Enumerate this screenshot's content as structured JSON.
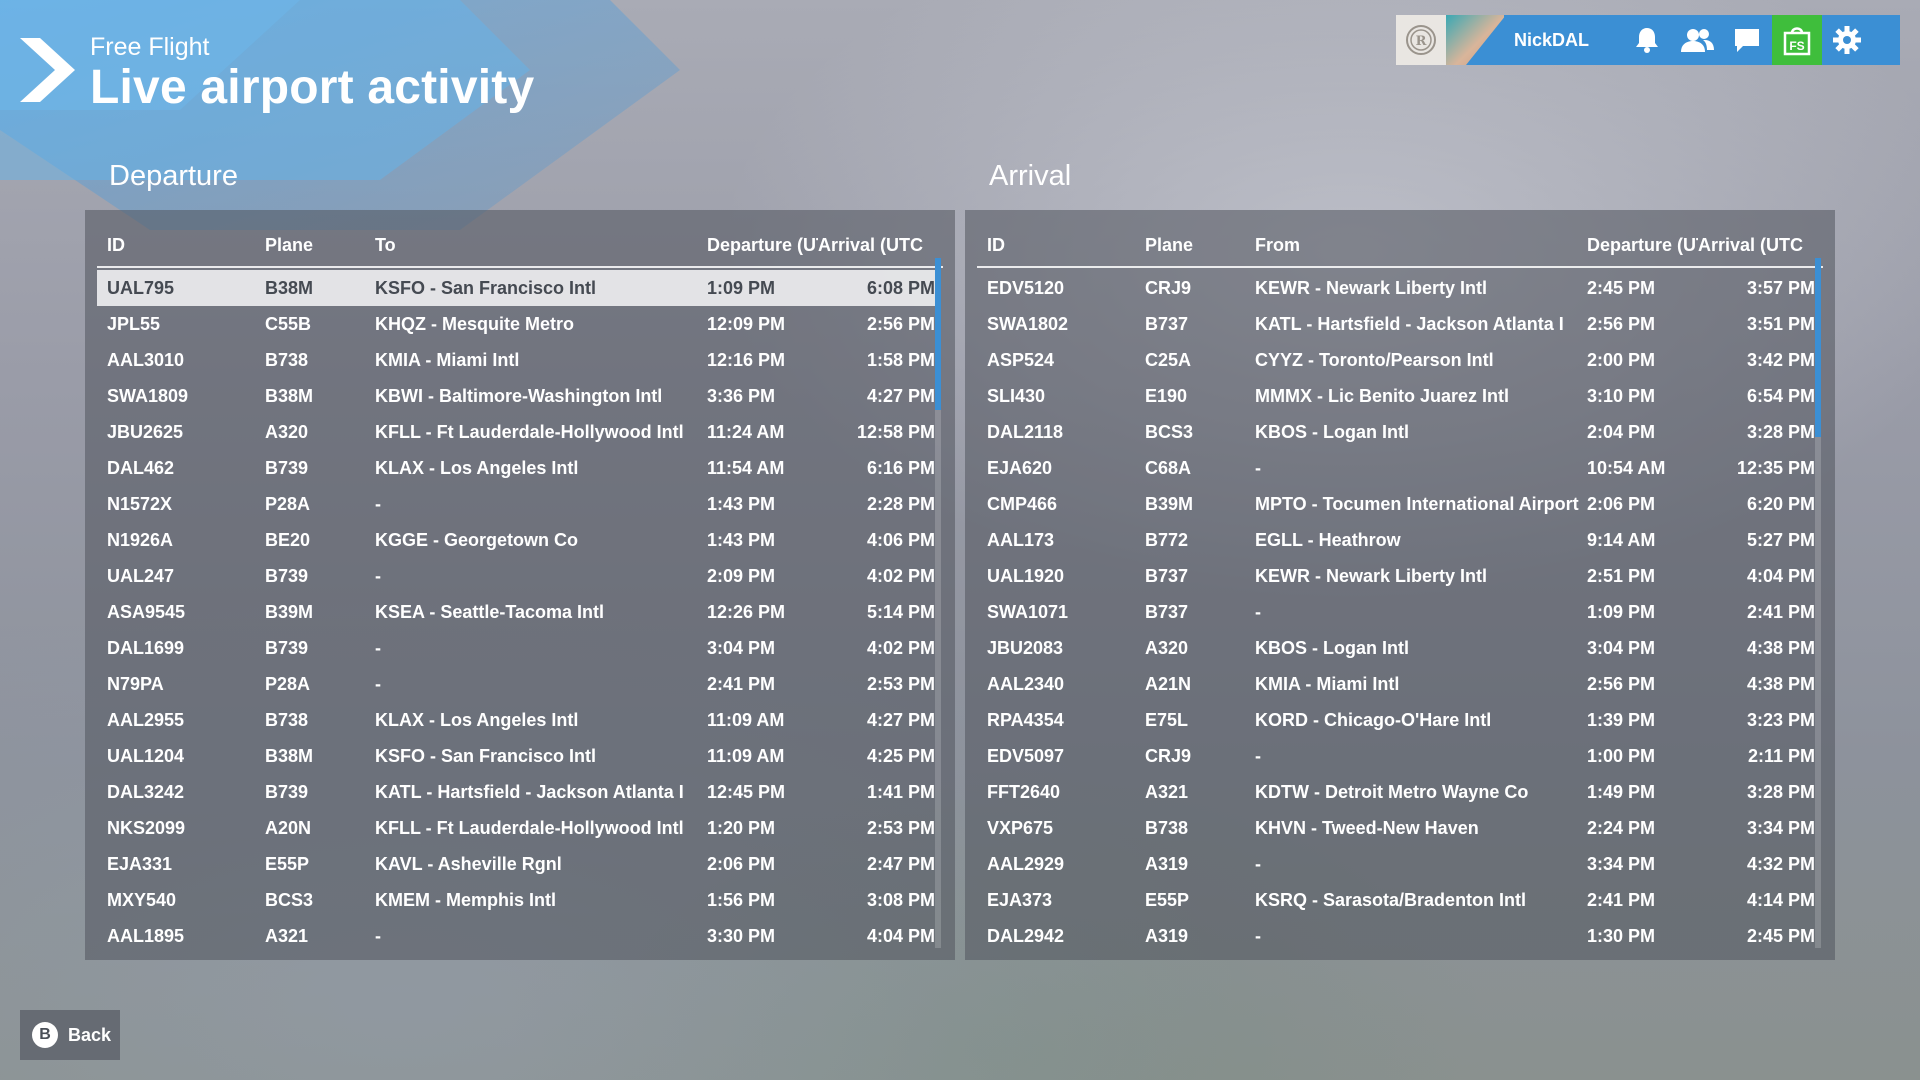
{
  "header": {
    "supertitle": "Free Flight",
    "title": "Live airport activity"
  },
  "topbar": {
    "username": "NickDAL",
    "icons": [
      "profile-badge-icon",
      "bell-icon",
      "friends-icon",
      "chat-icon",
      "store-icon",
      "gear-icon"
    ],
    "store_label": "FS",
    "store_color": "#3fbe3c",
    "accent_color": "#3b8fd4"
  },
  "departure": {
    "title": "Departure",
    "headers": [
      "ID",
      "Plane",
      "To",
      "Departure (UTC)",
      "Arrival (UTC)"
    ],
    "selected_row": 0,
    "rows": [
      [
        "UAL795",
        "B38M",
        "KSFO - San Francisco Intl",
        "1:09 PM",
        "6:08 PM"
      ],
      [
        "JPL55",
        "C55B",
        "KHQZ - Mesquite Metro",
        "12:09 PM",
        "2:56 PM"
      ],
      [
        "AAL3010",
        "B738",
        "KMIA - Miami Intl",
        "12:16 PM",
        "1:58 PM"
      ],
      [
        "SWA1809",
        "B38M",
        "KBWI - Baltimore-Washington Intl",
        "3:36 PM",
        "4:27 PM"
      ],
      [
        "JBU2625",
        "A320",
        "KFLL - Ft Lauderdale-Hollywood Intl",
        "11:24 AM",
        "12:58 PM"
      ],
      [
        "DAL462",
        "B739",
        "KLAX - Los Angeles Intl",
        "11:54 AM",
        "6:16 PM"
      ],
      [
        "N1572X",
        "P28A",
        "-",
        "1:43 PM",
        "2:28 PM"
      ],
      [
        "N1926A",
        "BE20",
        "KGGE - Georgetown Co",
        "1:43 PM",
        "4:06 PM"
      ],
      [
        "UAL247",
        "B739",
        "-",
        "2:09 PM",
        "4:02 PM"
      ],
      [
        "ASA9545",
        "B39M",
        "KSEA - Seattle-Tacoma Intl",
        "12:26 PM",
        "5:14 PM"
      ],
      [
        "DAL1699",
        "B739",
        "-",
        "3:04 PM",
        "4:02 PM"
      ],
      [
        "N79PA",
        "P28A",
        "-",
        "2:41 PM",
        "2:53 PM"
      ],
      [
        "AAL2955",
        "B738",
        "KLAX - Los Angeles Intl",
        "11:09 AM",
        "4:27 PM"
      ],
      [
        "UAL1204",
        "B38M",
        "KSFO - San Francisco Intl",
        "11:09 AM",
        "4:25 PM"
      ],
      [
        "DAL3242",
        "B739",
        "KATL - Hartsfield - Jackson Atlanta I",
        "12:45 PM",
        "1:41 PM"
      ],
      [
        "NKS2099",
        "A20N",
        "KFLL - Ft Lauderdale-Hollywood Intl",
        "1:20 PM",
        "2:53 PM"
      ],
      [
        "EJA331",
        "E55P",
        "KAVL - Asheville Rgnl",
        "2:06 PM",
        "2:47 PM"
      ],
      [
        "MXY540",
        "BCS3",
        "KMEM - Memphis Intl",
        "1:56 PM",
        "3:08 PM"
      ],
      [
        "AAL1895",
        "A321",
        "-",
        "3:30 PM",
        "4:04 PM"
      ]
    ],
    "scroll_fraction": 0.22
  },
  "arrival": {
    "title": "Arrival",
    "headers": [
      "ID",
      "Plane",
      "From",
      "Departure (UTC)",
      "Arrival (UTC)"
    ],
    "rows": [
      [
        "EDV5120",
        "CRJ9",
        "KEWR - Newark Liberty Intl",
        "2:45 PM",
        "3:57 PM"
      ],
      [
        "SWA1802",
        "B737",
        "KATL - Hartsfield - Jackson Atlanta I",
        "2:56 PM",
        "3:51 PM"
      ],
      [
        "ASP524",
        "C25A",
        "CYYZ - Toronto/Pearson Intl",
        "2:00 PM",
        "3:42 PM"
      ],
      [
        "SLI430",
        "E190",
        "MMMX - Lic Benito Juarez Intl",
        "3:10 PM",
        "6:54 PM"
      ],
      [
        "DAL2118",
        "BCS3",
        "KBOS - Logan Intl",
        "2:04 PM",
        "3:28 PM"
      ],
      [
        "EJA620",
        "C68A",
        "-",
        "10:54 AM",
        "12:35 PM"
      ],
      [
        "CMP466",
        "B39M",
        "MPTO - Tocumen International Airport",
        "2:06 PM",
        "6:20 PM"
      ],
      [
        "AAL173",
        "B772",
        "EGLL - Heathrow",
        "9:14 AM",
        "5:27 PM"
      ],
      [
        "UAL1920",
        "B737",
        "KEWR - Newark Liberty Intl",
        "2:51 PM",
        "4:04 PM"
      ],
      [
        "SWA1071",
        "B737",
        "-",
        "1:09 PM",
        "2:41 PM"
      ],
      [
        "JBU2083",
        "A320",
        "KBOS - Logan Intl",
        "3:04 PM",
        "4:38 PM"
      ],
      [
        "AAL2340",
        "A21N",
        "KMIA - Miami Intl",
        "2:56 PM",
        "4:38 PM"
      ],
      [
        "RPA4354",
        "E75L",
        "KORD - Chicago-O'Hare Intl",
        "1:39 PM",
        "3:23 PM"
      ],
      [
        "EDV5097",
        "CRJ9",
        "-",
        "1:00 PM",
        "2:11 PM"
      ],
      [
        "FFT2640",
        "A321",
        "KDTW - Detroit Metro Wayne Co",
        "1:49 PM",
        "3:28 PM"
      ],
      [
        "VXP675",
        "B738",
        "KHVN - Tweed-New Haven",
        "2:24 PM",
        "3:34 PM"
      ],
      [
        "AAL2929",
        "A319",
        "-",
        "3:34 PM",
        "4:32 PM"
      ],
      [
        "EJA373",
        "E55P",
        "KSRQ - Sarasota/Bradenton Intl",
        "2:41 PM",
        "4:14 PM"
      ],
      [
        "DAL2942",
        "A319",
        "-",
        "1:30 PM",
        "2:45 PM"
      ]
    ],
    "scroll_fraction": 0.26
  },
  "footer": {
    "back_key": "B",
    "back_label": "Back"
  }
}
